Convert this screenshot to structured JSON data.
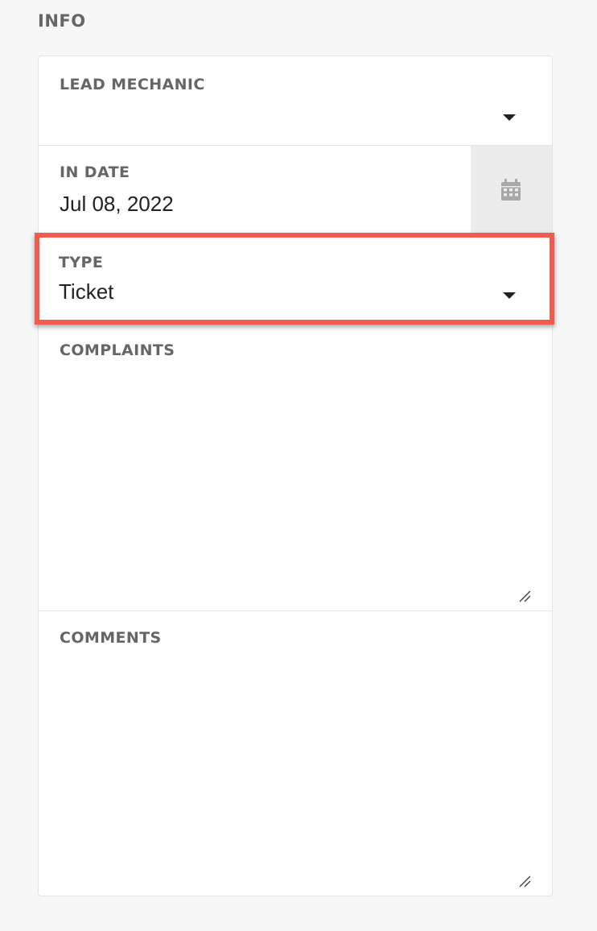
{
  "section": {
    "title": "INFO"
  },
  "fields": {
    "lead_mechanic": {
      "label": "LEAD MECHANIC",
      "value": ""
    },
    "in_date": {
      "label": "IN DATE",
      "value": "Jul 08, 2022"
    },
    "type": {
      "label": "TYPE",
      "value": "Ticket"
    },
    "complaints": {
      "label": "COMPLAINTS",
      "value": ""
    },
    "comments": {
      "label": "COMMENTS",
      "value": ""
    }
  },
  "icons": {
    "dropdown": "chevron-down-icon",
    "calendar": "calendar-icon",
    "resize": "resize-handle-icon"
  },
  "colors": {
    "highlight_border": "#f35b4f",
    "calendar_button_bg": "#ececec",
    "label_text": "#666666"
  }
}
